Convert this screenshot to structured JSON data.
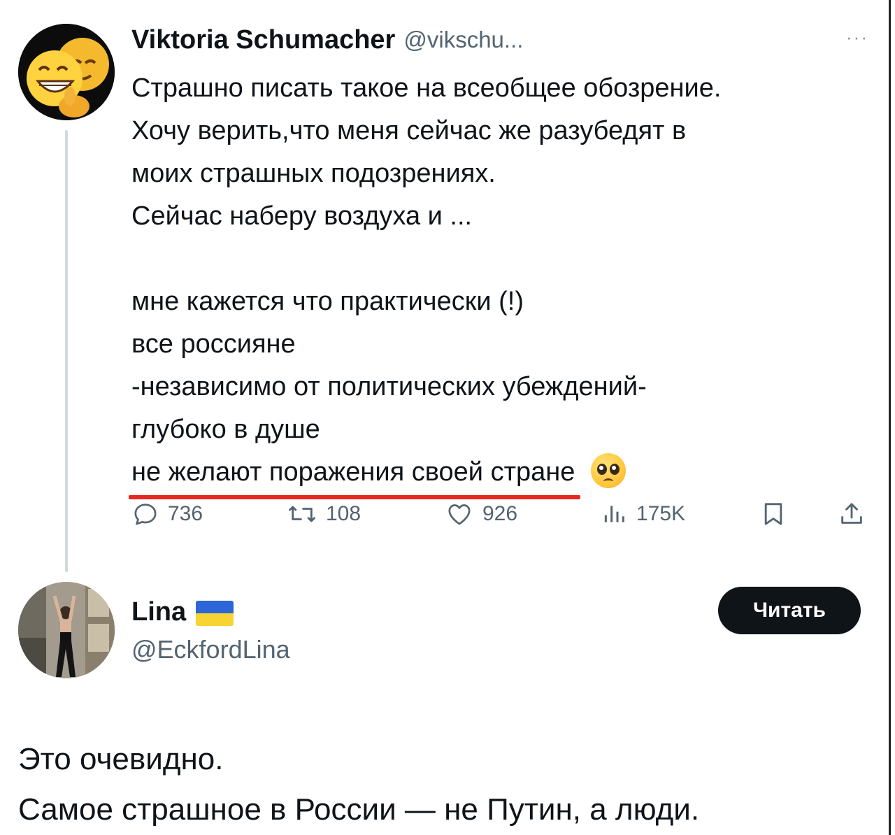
{
  "tweet": {
    "author_name": "Viktoria Schumacher",
    "author_handle": "@vikschu...",
    "more_icon": "···",
    "lines": [
      "Страшно писать такое на всеобщее обозрение.",
      "Хочу верить,что меня сейчас же разубедят в",
      "моих страшных подозрениях.",
      "Сейчас наберу воздуха и ...",
      "",
      "мне кажется что практически (!)",
      "все россияне",
      "-независимо от политических убеждений-",
      "глубоко в душе"
    ],
    "highlighted_line": "не желают поражения своей стране",
    "emoji": "pleading-face",
    "highlight_color": "#e8281d",
    "actions": {
      "replies": "736",
      "retweets": "108",
      "likes": "926",
      "views": "175K"
    }
  },
  "reply_author": {
    "name": "Lina",
    "flag": "ukraine-flag",
    "handle": "@EckfordLina",
    "follow_label": "Читать"
  },
  "reply": {
    "lines": [
      "Это очевидно.",
      "Самое страшное в России — не Путин, а люди."
    ]
  },
  "colors": {
    "text": "#0f1419",
    "secondary": "#536471",
    "button_bg": "#0f1419",
    "thread_line": "#cfd9de"
  }
}
